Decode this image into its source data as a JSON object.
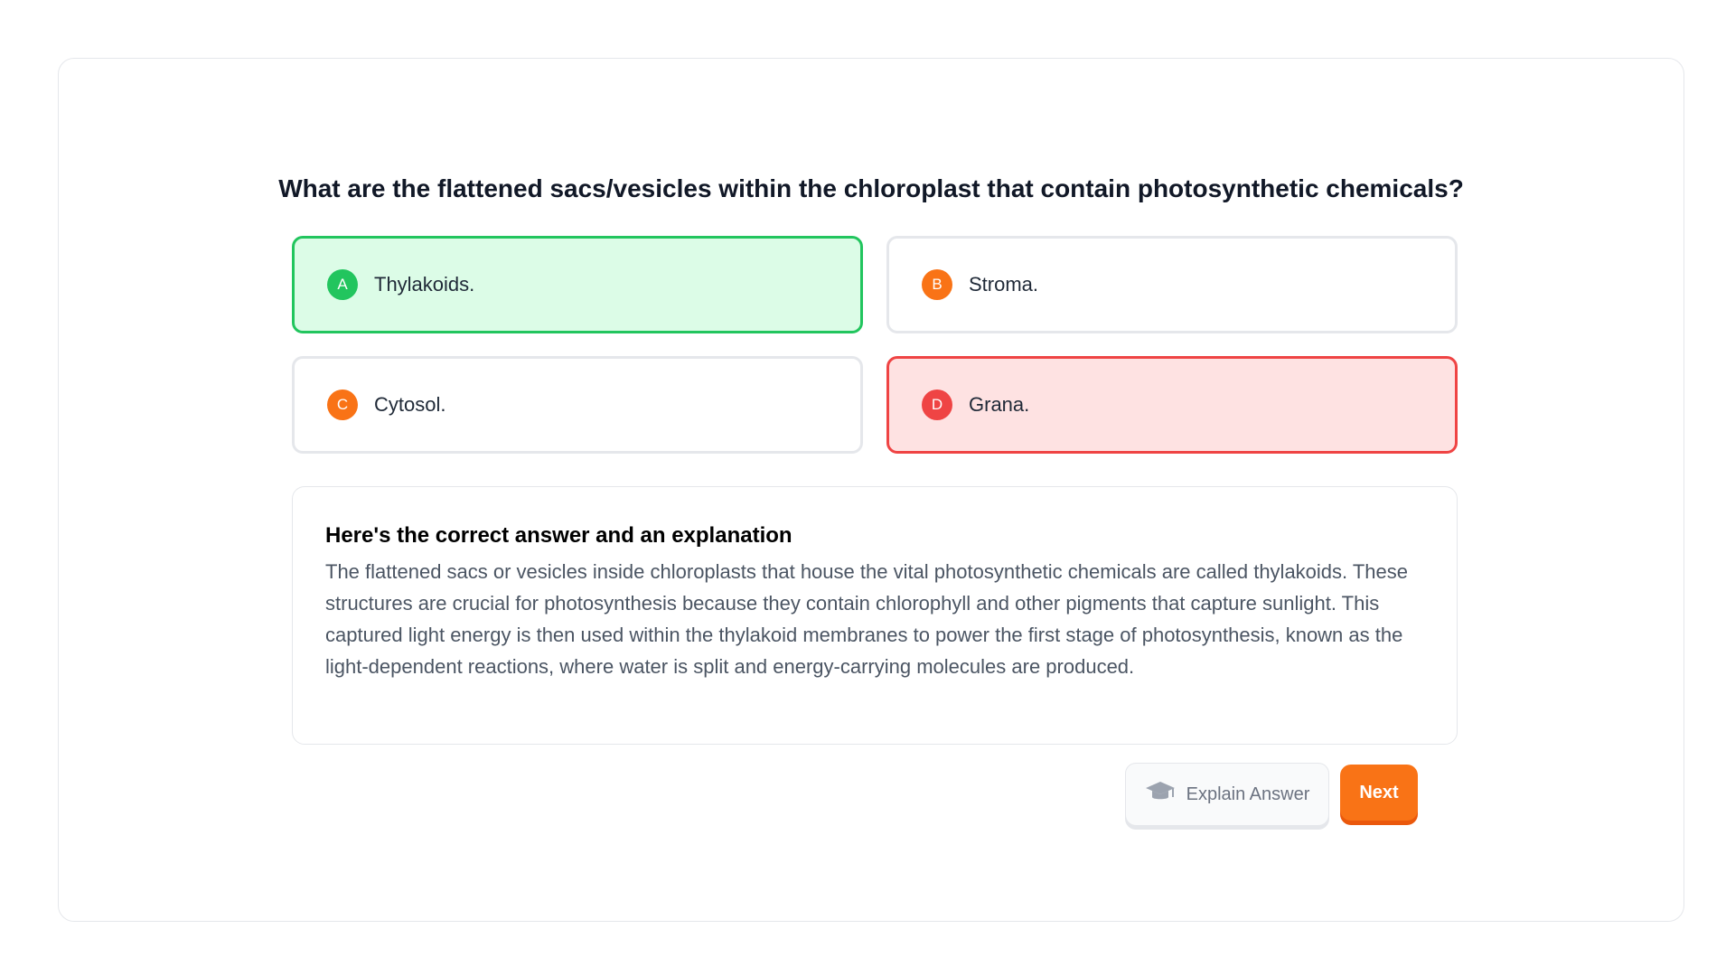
{
  "question": "What are the flattened sacs/vesicles within the chloroplast that contain photosynthetic chemicals?",
  "options": [
    {
      "letter": "A",
      "text": "Thylakoids.",
      "state": "correct"
    },
    {
      "letter": "B",
      "text": "Stroma.",
      "state": "neutral"
    },
    {
      "letter": "C",
      "text": "Cytosol.",
      "state": "neutral"
    },
    {
      "letter": "D",
      "text": "Grana.",
      "state": "wrong"
    }
  ],
  "explanation": {
    "title": "Here's the correct answer and an explanation",
    "body": "The flattened sacs or vesicles inside chloroplasts that house the vital photosynthetic chemicals are called thylakoids. These structures are crucial for photosynthesis because they contain chlorophyll and other pigments that capture sunlight. This captured light energy is then used within the thylakoid membranes to power the first stage of photosynthesis, known as the light-dependent reactions, where water is split and energy-carrying molecules are produced."
  },
  "actions": {
    "explain_label": "Explain Answer",
    "explain_icon": "graduation-cap-icon",
    "next_label": "Next"
  },
  "colors": {
    "correct_border": "#22c55e",
    "correct_bg": "#dcfce7",
    "wrong_border": "#ef4444",
    "wrong_bg": "#fee2e2",
    "accent": "#f97316"
  }
}
